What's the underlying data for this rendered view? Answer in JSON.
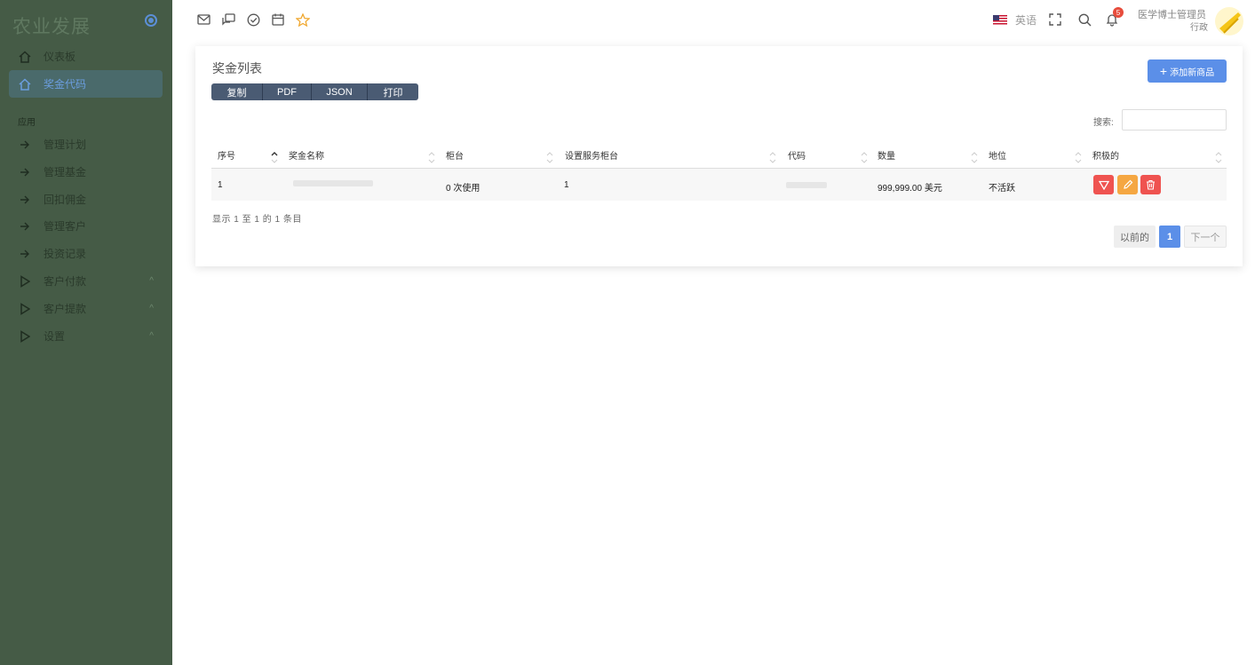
{
  "sidebar": {
    "brand": "农业发展",
    "section_label": "应用",
    "items": [
      {
        "label": "仪表板",
        "icon": "home-icon"
      },
      {
        "label": "奖金代码",
        "icon": "home-icon",
        "active": true
      },
      {
        "label": "管理计划",
        "icon": "arrow-right-icon"
      },
      {
        "label": "管理基金",
        "icon": "arrow-right-icon"
      },
      {
        "label": "回扣佣金",
        "icon": "arrow-right-icon"
      },
      {
        "label": "管理客户",
        "icon": "arrow-right-icon"
      },
      {
        "label": "投资记录",
        "icon": "arrow-right-icon"
      },
      {
        "label": "客户付款",
        "icon": "play-icon",
        "has_submenu": true
      },
      {
        "label": "客户提款",
        "icon": "play-icon",
        "has_submenu": true
      },
      {
        "label": "设置",
        "icon": "play-icon",
        "has_submenu": true
      }
    ],
    "chevron": "^"
  },
  "topbar": {
    "icons": [
      "mail-icon",
      "chat-icon",
      "check-circle-icon",
      "calendar-icon",
      "star-icon"
    ],
    "language": "英语",
    "notification_count": "5",
    "user_name": "医学博士管理员",
    "user_role": "行政"
  },
  "card": {
    "title": "奖金列表",
    "add_button": "添加新商品",
    "add_plus": "+",
    "export_buttons": [
      "复制",
      "PDF",
      "JSON",
      "打印"
    ],
    "search_label": "搜索:",
    "columns": [
      "序号",
      "奖金名称",
      "柜台",
      "设置服务柜台",
      "代码",
      "数量",
      "地位",
      "积极的"
    ],
    "rows": [
      {
        "index": "1",
        "counter": "0 次使用",
        "service_counter": "1",
        "amount": "999,999.00 美元",
        "status": "不活跃"
      }
    ],
    "info": "显示 1 至 1 的 1 条目",
    "pagination": {
      "prev": "以前的",
      "current": "1",
      "next": "下一个"
    }
  },
  "colors": {
    "sidebar_bg": "#455b46",
    "accent_blue": "#5b8fe8",
    "btn_red": "#ef5350",
    "btn_orange": "#f5a742",
    "export_bg": "#4a5b73"
  }
}
